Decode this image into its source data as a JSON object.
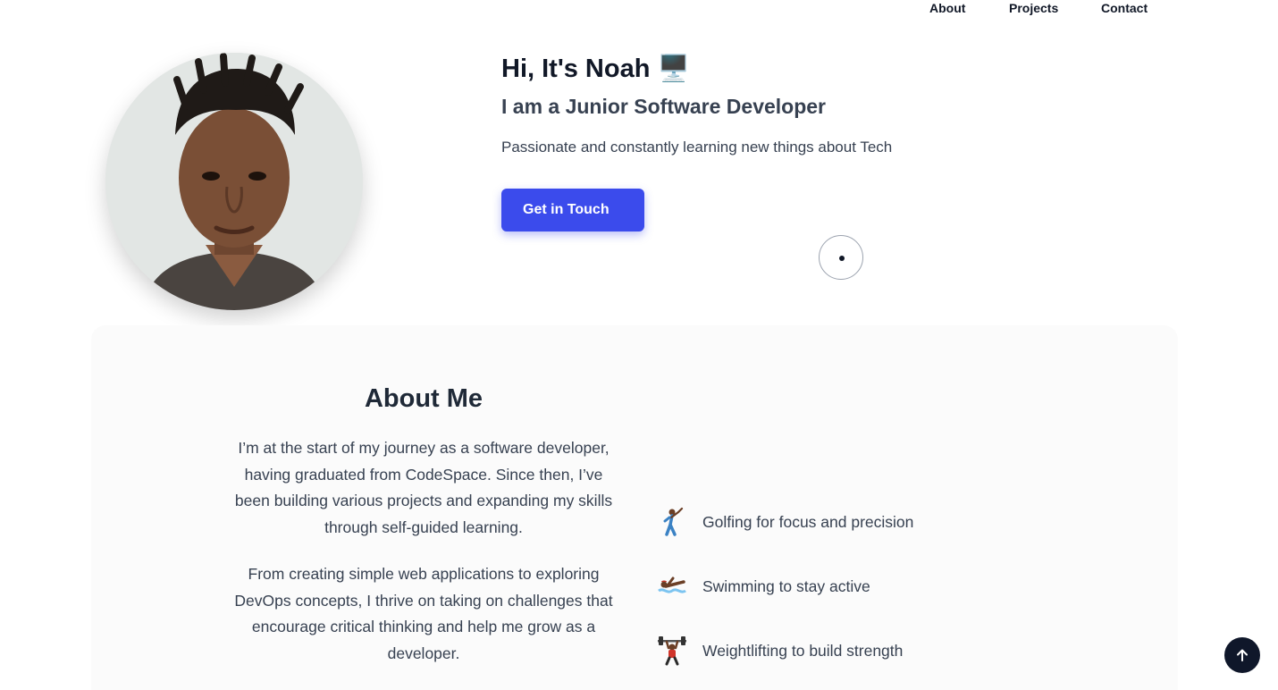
{
  "nav": {
    "items": [
      {
        "label": "About"
      },
      {
        "label": "Projects"
      },
      {
        "label": "Contact"
      }
    ]
  },
  "hero": {
    "greeting": "Hi, It's Noah 🖥️",
    "subtitle": "I am a Junior Software Developer",
    "description": "Passionate and constantly learning new things about Tech",
    "cta_label": "Get in Touch",
    "avatar_icon": "portrait-photo"
  },
  "about": {
    "title": "About Me",
    "paragraphs": [
      "I’m at the start of my journey as a software developer, having graduated from CodeSpace. Since then, I’ve been building various projects and expanding my skills through self-guided learning.",
      "From creating simple web applications to exploring DevOps concepts, I thrive on taking on challenges that encourage critical thinking and help me grow as a developer."
    ],
    "hobbies": [
      {
        "icon": "golfer-icon",
        "label": "Golfing for focus and precision"
      },
      {
        "icon": "swimmer-icon",
        "label": "Swimming to stay active"
      },
      {
        "icon": "weightlifter-icon",
        "label": "Weightlifting to build strength"
      }
    ]
  },
  "scroll_top_icon": "arrow-up-icon",
  "colors": {
    "accent": "#3b4bec",
    "dark": "#0f172a",
    "section_bg": "#fbfbfb"
  }
}
